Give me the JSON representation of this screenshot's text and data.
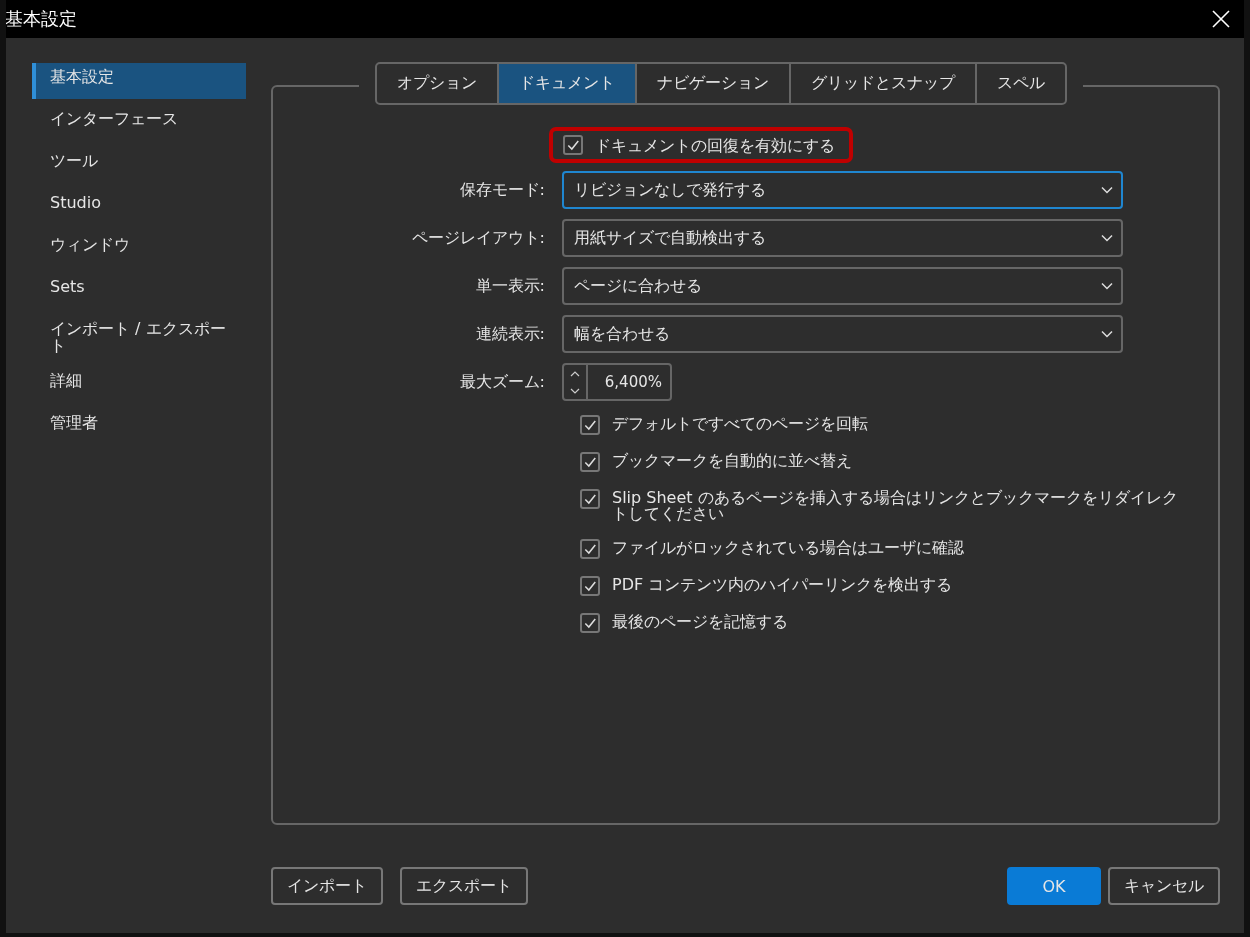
{
  "window": {
    "title": "基本設定"
  },
  "sidebar": {
    "items": [
      {
        "label": "基本設定",
        "selected": true
      },
      {
        "label": "インターフェース",
        "selected": false
      },
      {
        "label": "ツール",
        "selected": false
      },
      {
        "label": "Studio",
        "selected": false
      },
      {
        "label": "ウィンドウ",
        "selected": false
      },
      {
        "label": "Sets",
        "selected": false
      },
      {
        "label": "インポート / エクスポート",
        "selected": false
      },
      {
        "label": "詳細",
        "selected": false
      },
      {
        "label": "管理者",
        "selected": false
      }
    ]
  },
  "tabs": [
    {
      "label": "オプション",
      "selected": false
    },
    {
      "label": "ドキュメント",
      "selected": true
    },
    {
      "label": "ナビゲーション",
      "selected": false
    },
    {
      "label": "グリッドとスナップ",
      "selected": false
    },
    {
      "label": "スペル",
      "selected": false
    }
  ],
  "recovery": {
    "label": "ドキュメントの回復を有効にする",
    "checked": true,
    "highlighted": true
  },
  "fields": [
    {
      "label": "保存モード:",
      "kind": "dropdown",
      "value": "リビジョンなしで発行する",
      "focused": true
    },
    {
      "label": "ページレイアウト:",
      "kind": "dropdown",
      "value": "用紙サイズで自動検出する",
      "focused": false
    },
    {
      "label": "単一表示:",
      "kind": "dropdown",
      "value": "ページに合わせる",
      "focused": false
    },
    {
      "label": "連続表示:",
      "kind": "dropdown",
      "value": "幅を合わせる",
      "focused": false
    },
    {
      "label": "最大ズーム:",
      "kind": "spinner",
      "value": "6,400%",
      "focused": false
    }
  ],
  "options": [
    {
      "label": "デフォルトですべてのページを回転",
      "checked": true
    },
    {
      "label": "ブックマークを自動的に並べ替え",
      "checked": true
    },
    {
      "label": "Slip Sheet のあるページを挿入する場合はリンクとブックマークをリダイレクトしてください",
      "checked": true
    },
    {
      "label": "ファイルがロックされている場合はユーザに確認",
      "checked": true
    },
    {
      "label": "PDF コンテンツ内のハイパーリンクを検出する",
      "checked": true
    },
    {
      "label": "最後のページを記憶する",
      "checked": true
    }
  ],
  "footer": {
    "left_buttons": [
      "インポート",
      "エクスポート"
    ],
    "ok": "OK",
    "cancel": "キャンセル"
  }
}
